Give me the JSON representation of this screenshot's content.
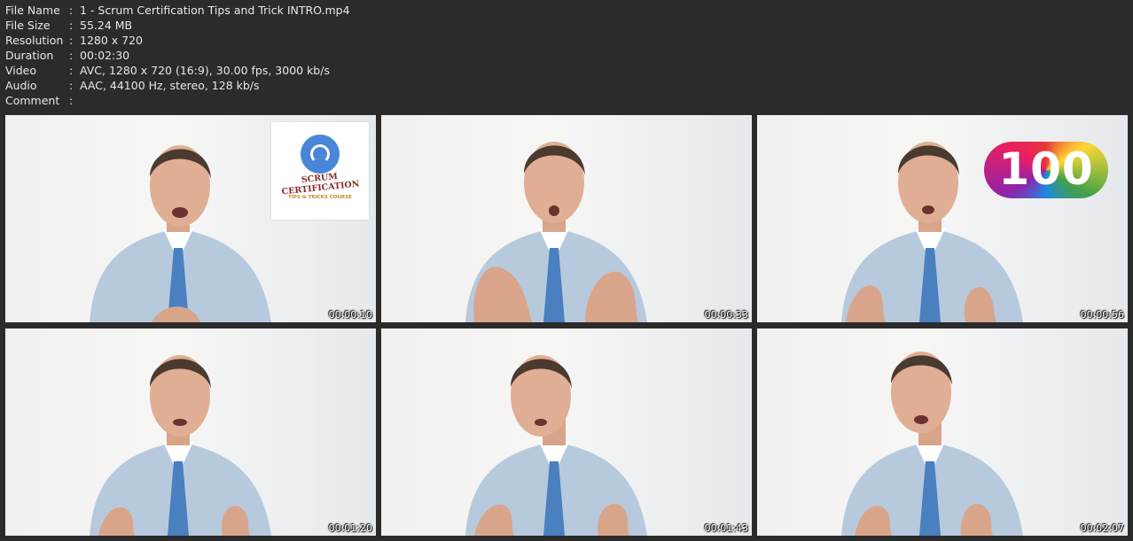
{
  "info": [
    {
      "key": "File Name",
      "sep": ":",
      "value": "1 - Scrum Certification Tips and Trick INTRO.mp4"
    },
    {
      "key": "File Size",
      "sep": ":",
      "value": "55.24 MB"
    },
    {
      "key": "Resolution",
      "sep": ":",
      "value": "1280 x 720"
    },
    {
      "key": "Duration",
      "sep": ":",
      "value": "00:02:30"
    },
    {
      "key": "Video",
      "sep": ":",
      "value": "AVC, 1280 x 720 (16:9), 30.00 fps, 3000 kb/s"
    },
    {
      "key": "Audio",
      "sep": ":",
      "value": "AAC, 44100 Hz, stereo, 128 kb/s"
    },
    {
      "key": "Comment",
      "sep": ":",
      "value": ""
    }
  ],
  "thumbnails": [
    {
      "timestamp": "00:00:10",
      "overlay": "logo"
    },
    {
      "timestamp": "00:00:33",
      "overlay": "none"
    },
    {
      "timestamp": "00:00:56",
      "overlay": "hundred"
    },
    {
      "timestamp": "00:01:20",
      "overlay": "none"
    },
    {
      "timestamp": "00:01:43",
      "overlay": "none"
    },
    {
      "timestamp": "00:02:07",
      "overlay": "none"
    }
  ],
  "logo": {
    "title": "SCRUM CERTIFICATION",
    "subtitle": "TIPS & TRICKS COURSE"
  },
  "hundred_text": "100",
  "colors": {
    "background": "#2b2b2b",
    "text": "#e8e8e8",
    "suit": "#b7c9dc",
    "tie": "#4a7fc0",
    "logo_blue": "#4a86d8",
    "logo_red": "#8a2b2b"
  }
}
